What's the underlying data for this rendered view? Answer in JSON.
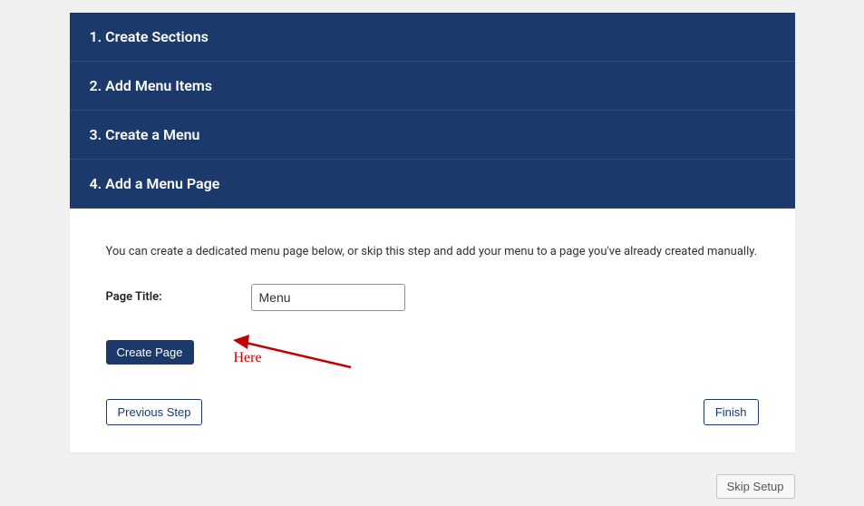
{
  "steps": [
    {
      "label": "1. Create Sections"
    },
    {
      "label": "2. Add Menu Items"
    },
    {
      "label": "3. Create a Menu"
    },
    {
      "label": "4. Add a Menu Page"
    }
  ],
  "content": {
    "description": "You can create a dedicated menu page below, or skip this step and add your menu to a page you've already created manually.",
    "page_title_label": "Page Title:",
    "page_title_value": "Menu",
    "create_page_label": "Create Page"
  },
  "annotation": "Here",
  "nav": {
    "previous": "Previous Step",
    "finish": "Finish",
    "skip": "Skip Setup"
  }
}
